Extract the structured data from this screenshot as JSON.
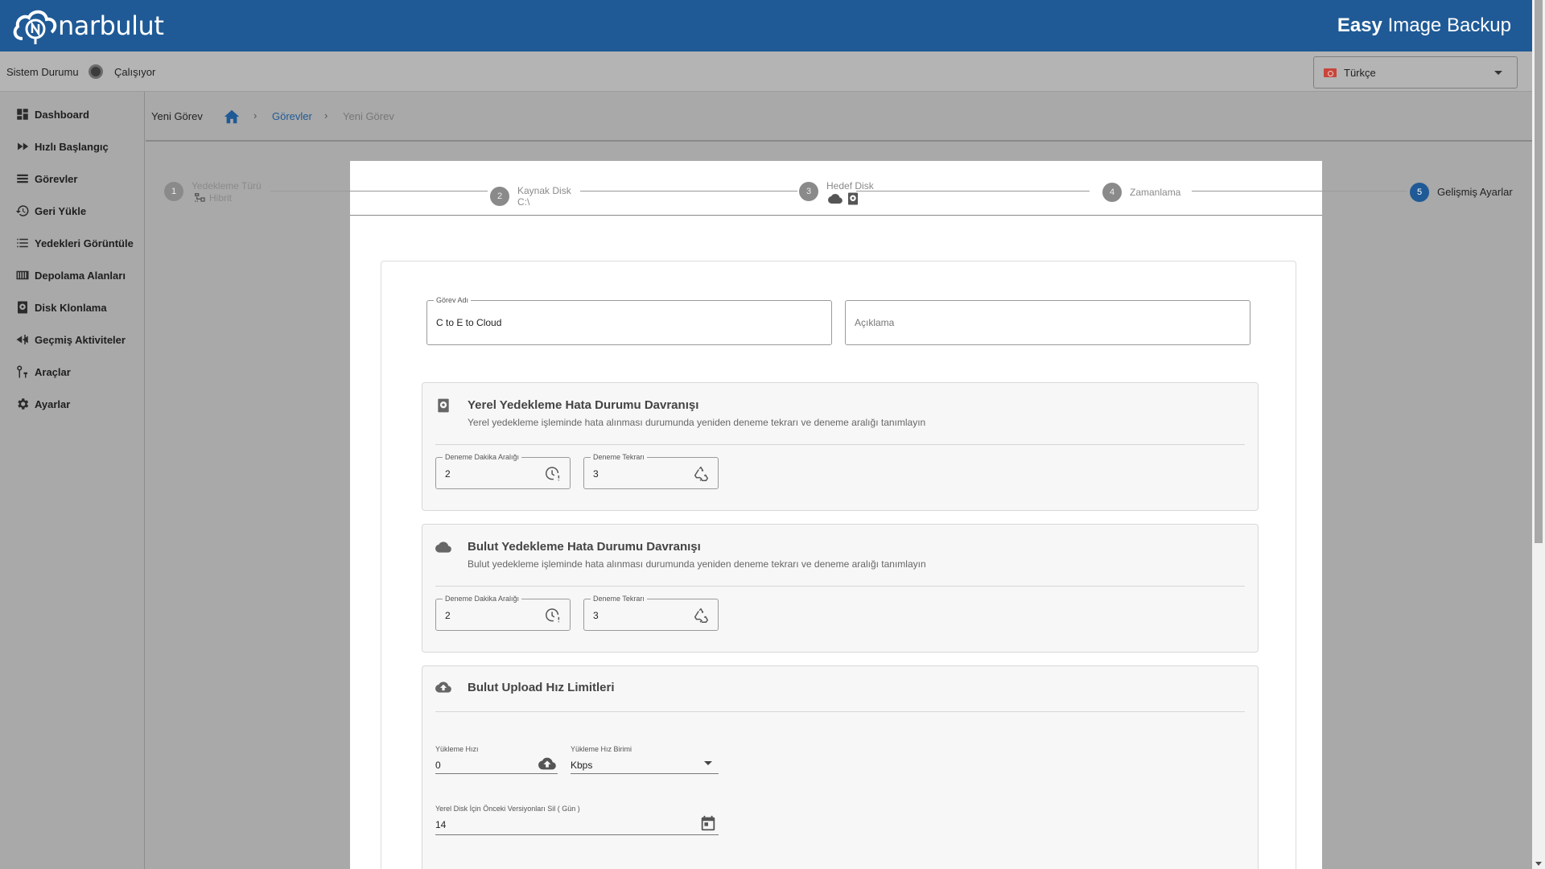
{
  "header": {
    "logo_text": "narbulut",
    "app_title_bold": "Easy",
    "app_title_rest": " Image Backup"
  },
  "status": {
    "label": "Sistem Durumu",
    "value": "Çalışıyor"
  },
  "language": {
    "selected": "Türkçe"
  },
  "sidebar": {
    "items": [
      {
        "label": "Dashboard",
        "icon": "dashboard-icon"
      },
      {
        "label": "Hızlı Başlangıç",
        "icon": "fast-forward-icon"
      },
      {
        "label": "Görevler",
        "icon": "list-icon"
      },
      {
        "label": "Geri Yükle",
        "icon": "restore-icon"
      },
      {
        "label": "Yedekleri Görüntüle",
        "icon": "view-list-icon"
      },
      {
        "label": "Depolama Alanları",
        "icon": "storage-icon"
      },
      {
        "label": "Disk Klonlama",
        "icon": "disk-icon"
      },
      {
        "label": "Geçmiş Aktiviteler",
        "icon": "history-icon"
      },
      {
        "label": "Araçlar",
        "icon": "tools-icon"
      },
      {
        "label": "Ayarlar",
        "icon": "settings-icon"
      }
    ]
  },
  "breadcrumb": {
    "page_title": "Yeni Görev",
    "link": "Görevler",
    "current": "Yeni Görev",
    "separator": "›"
  },
  "stepper": {
    "steps": [
      {
        "num": "1",
        "title": "Yedekleme Türü",
        "sub": "Hibrit"
      },
      {
        "num": "2",
        "title": "Kaynak Disk",
        "sub": "C:\\"
      },
      {
        "num": "3",
        "title": "Hedef Disk",
        "sub": ""
      },
      {
        "num": "4",
        "title": "Zamanlama",
        "sub": ""
      },
      {
        "num": "5",
        "title": "Gelişmiş Ayarlar",
        "sub": ""
      }
    ]
  },
  "form": {
    "task_name_label": "Görev Adı",
    "task_name_value": "C to E to Cloud",
    "description_placeholder": "Açıklama"
  },
  "local_section": {
    "title": "Yerel Yedekleme Hata Durumu Davranışı",
    "desc": "Yerel yedekleme işleminde hata alınması durumunda yeniden deneme tekrarı ve deneme aralığı tanımlayın",
    "interval_label": "Deneme Dakika Aralığı",
    "interval_value": "2",
    "retry_label": "Deneme Tekrarı",
    "retry_value": "3"
  },
  "cloud_section": {
    "title": "Bulut Yedekleme Hata Durumu Davranışı",
    "desc": "Bulut yedekleme işleminde hata alınması durumunda yeniden deneme tekrarı ve deneme aralığı tanımlayın",
    "interval_label": "Deneme Dakika Aralığı",
    "interval_value": "2",
    "retry_label": "Deneme Tekrarı",
    "retry_value": "3"
  },
  "upload_section": {
    "title": "Bulut Upload Hız Limitleri",
    "speed_label": "Yükleme Hızı",
    "speed_value": "0",
    "unit_label": "Yükleme Hız Birimi",
    "unit_value": "Kbps",
    "retention_label": "Yerel Disk İçin Önceki Versiyonları Sil ( Gün )",
    "retention_value": "14"
  },
  "colors": {
    "brand": "#1f5a96",
    "overlay": "#a9a9a9"
  }
}
